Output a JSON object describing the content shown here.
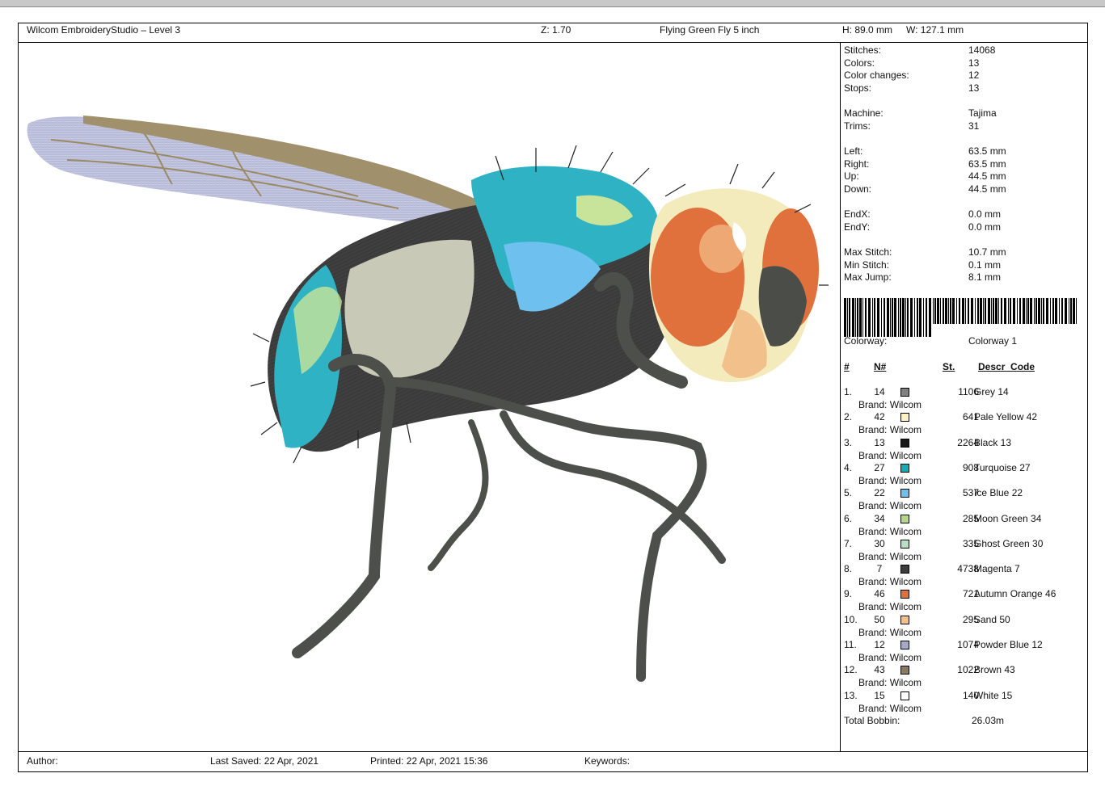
{
  "header": {
    "app_title": "Wilcom EmbroideryStudio – Level 3",
    "zoom": "Z: 1.70",
    "design_name": "Flying Green Fly 5 inch",
    "height": "H: 89.0 mm",
    "width": "W: 127.1 mm"
  },
  "stats": [
    {
      "label": "Stitches:",
      "value": "14068"
    },
    {
      "label": "Colors:",
      "value": "13"
    },
    {
      "label": "Color changes:",
      "value": "12"
    },
    {
      "label": "Stops:",
      "value": "13"
    },
    {
      "label": "Machine:",
      "value": "Tajima"
    },
    {
      "label": "Trims:",
      "value": "31"
    },
    {
      "label": "Left:",
      "value": "63.5 mm"
    },
    {
      "label": "Right:",
      "value": "63.5 mm"
    },
    {
      "label": "Up:",
      "value": "44.5 mm"
    },
    {
      "label": "Down:",
      "value": "44.5 mm"
    },
    {
      "label": "EndX:",
      "value": "0.0 mm"
    },
    {
      "label": "EndY:",
      "value": "0.0 mm"
    },
    {
      "label": "Max Stitch:",
      "value": "10.7 mm"
    },
    {
      "label": "Min Stitch:",
      "value": "0.1 mm"
    },
    {
      "label": "Max Jump:",
      "value": "8.1 mm"
    }
  ],
  "colorway": {
    "label": "Colorway:",
    "value": "Colorway 1"
  },
  "columns": {
    "index": "#",
    "needle": "N#",
    "stitches": "St.",
    "descr": "Descr_Code"
  },
  "colors": [
    {
      "index": "1.",
      "needle": "14",
      "swatch": "#808080",
      "brand": "Brand: Wilcom",
      "stitches": "1106",
      "descr": "Grey 14"
    },
    {
      "index": "2.",
      "needle": "42",
      "swatch": "#fbf3c2",
      "brand": "Brand: Wilcom",
      "stitches": "641",
      "descr": "Pale Yellow 42"
    },
    {
      "index": "3.",
      "needle": "13",
      "swatch": "#1a1a1a",
      "brand": "Brand: Wilcom",
      "stitches": "2264",
      "descr": "Black 13"
    },
    {
      "index": "4.",
      "needle": "27",
      "swatch": "#18a8b8",
      "brand": "Brand: Wilcom",
      "stitches": "908",
      "descr": "Turquoise 27"
    },
    {
      "index": "5.",
      "needle": "22",
      "swatch": "#6ec0ee",
      "brand": "Brand: Wilcom",
      "stitches": "537",
      "descr": "Ice Blue 22"
    },
    {
      "index": "6.",
      "needle": "34",
      "swatch": "#b4d884",
      "brand": "Brand: Wilcom",
      "stitches": "285",
      "descr": "Moon Green 34"
    },
    {
      "index": "7.",
      "needle": "30",
      "swatch": "#b8e0c4",
      "brand": "Brand: Wilcom",
      "stitches": "335",
      "descr": "Ghost Green 30"
    },
    {
      "index": "8.",
      "needle": "7",
      "swatch": "#3c3c3c",
      "brand": "Brand: Wilcom",
      "stitches": "4738",
      "descr": "Magenta 7"
    },
    {
      "index": "9.",
      "needle": "46",
      "swatch": "#e0703c",
      "brand": "Brand: Wilcom",
      "stitches": "721",
      "descr": "Autumn Orange 46"
    },
    {
      "index": "10.",
      "needle": "50",
      "swatch": "#f2c08a",
      "brand": "Brand: Wilcom",
      "stitches": "295",
      "descr": "Sand 50"
    },
    {
      "index": "11.",
      "needle": "12",
      "swatch": "#a8a8c8",
      "brand": "Brand: Wilcom",
      "stitches": "1074",
      "descr": "Powder Blue 12"
    },
    {
      "index": "12.",
      "needle": "43",
      "swatch": "#8a7a62",
      "brand": "Brand: Wilcom",
      "stitches": "1022",
      "descr": "Brown 43"
    },
    {
      "index": "13.",
      "needle": "15",
      "swatch": "#ffffff",
      "brand": "Brand: Wilcom",
      "stitches": "140",
      "descr": "White 15"
    }
  ],
  "total": {
    "label": "Total Bobbin:",
    "value": "26.03m"
  },
  "footer": {
    "author": "Author:",
    "last_saved": "Last Saved: 22 Apr, 2021",
    "printed": "Printed: 22 Apr, 2021 15:36",
    "keywords": "Keywords:"
  }
}
